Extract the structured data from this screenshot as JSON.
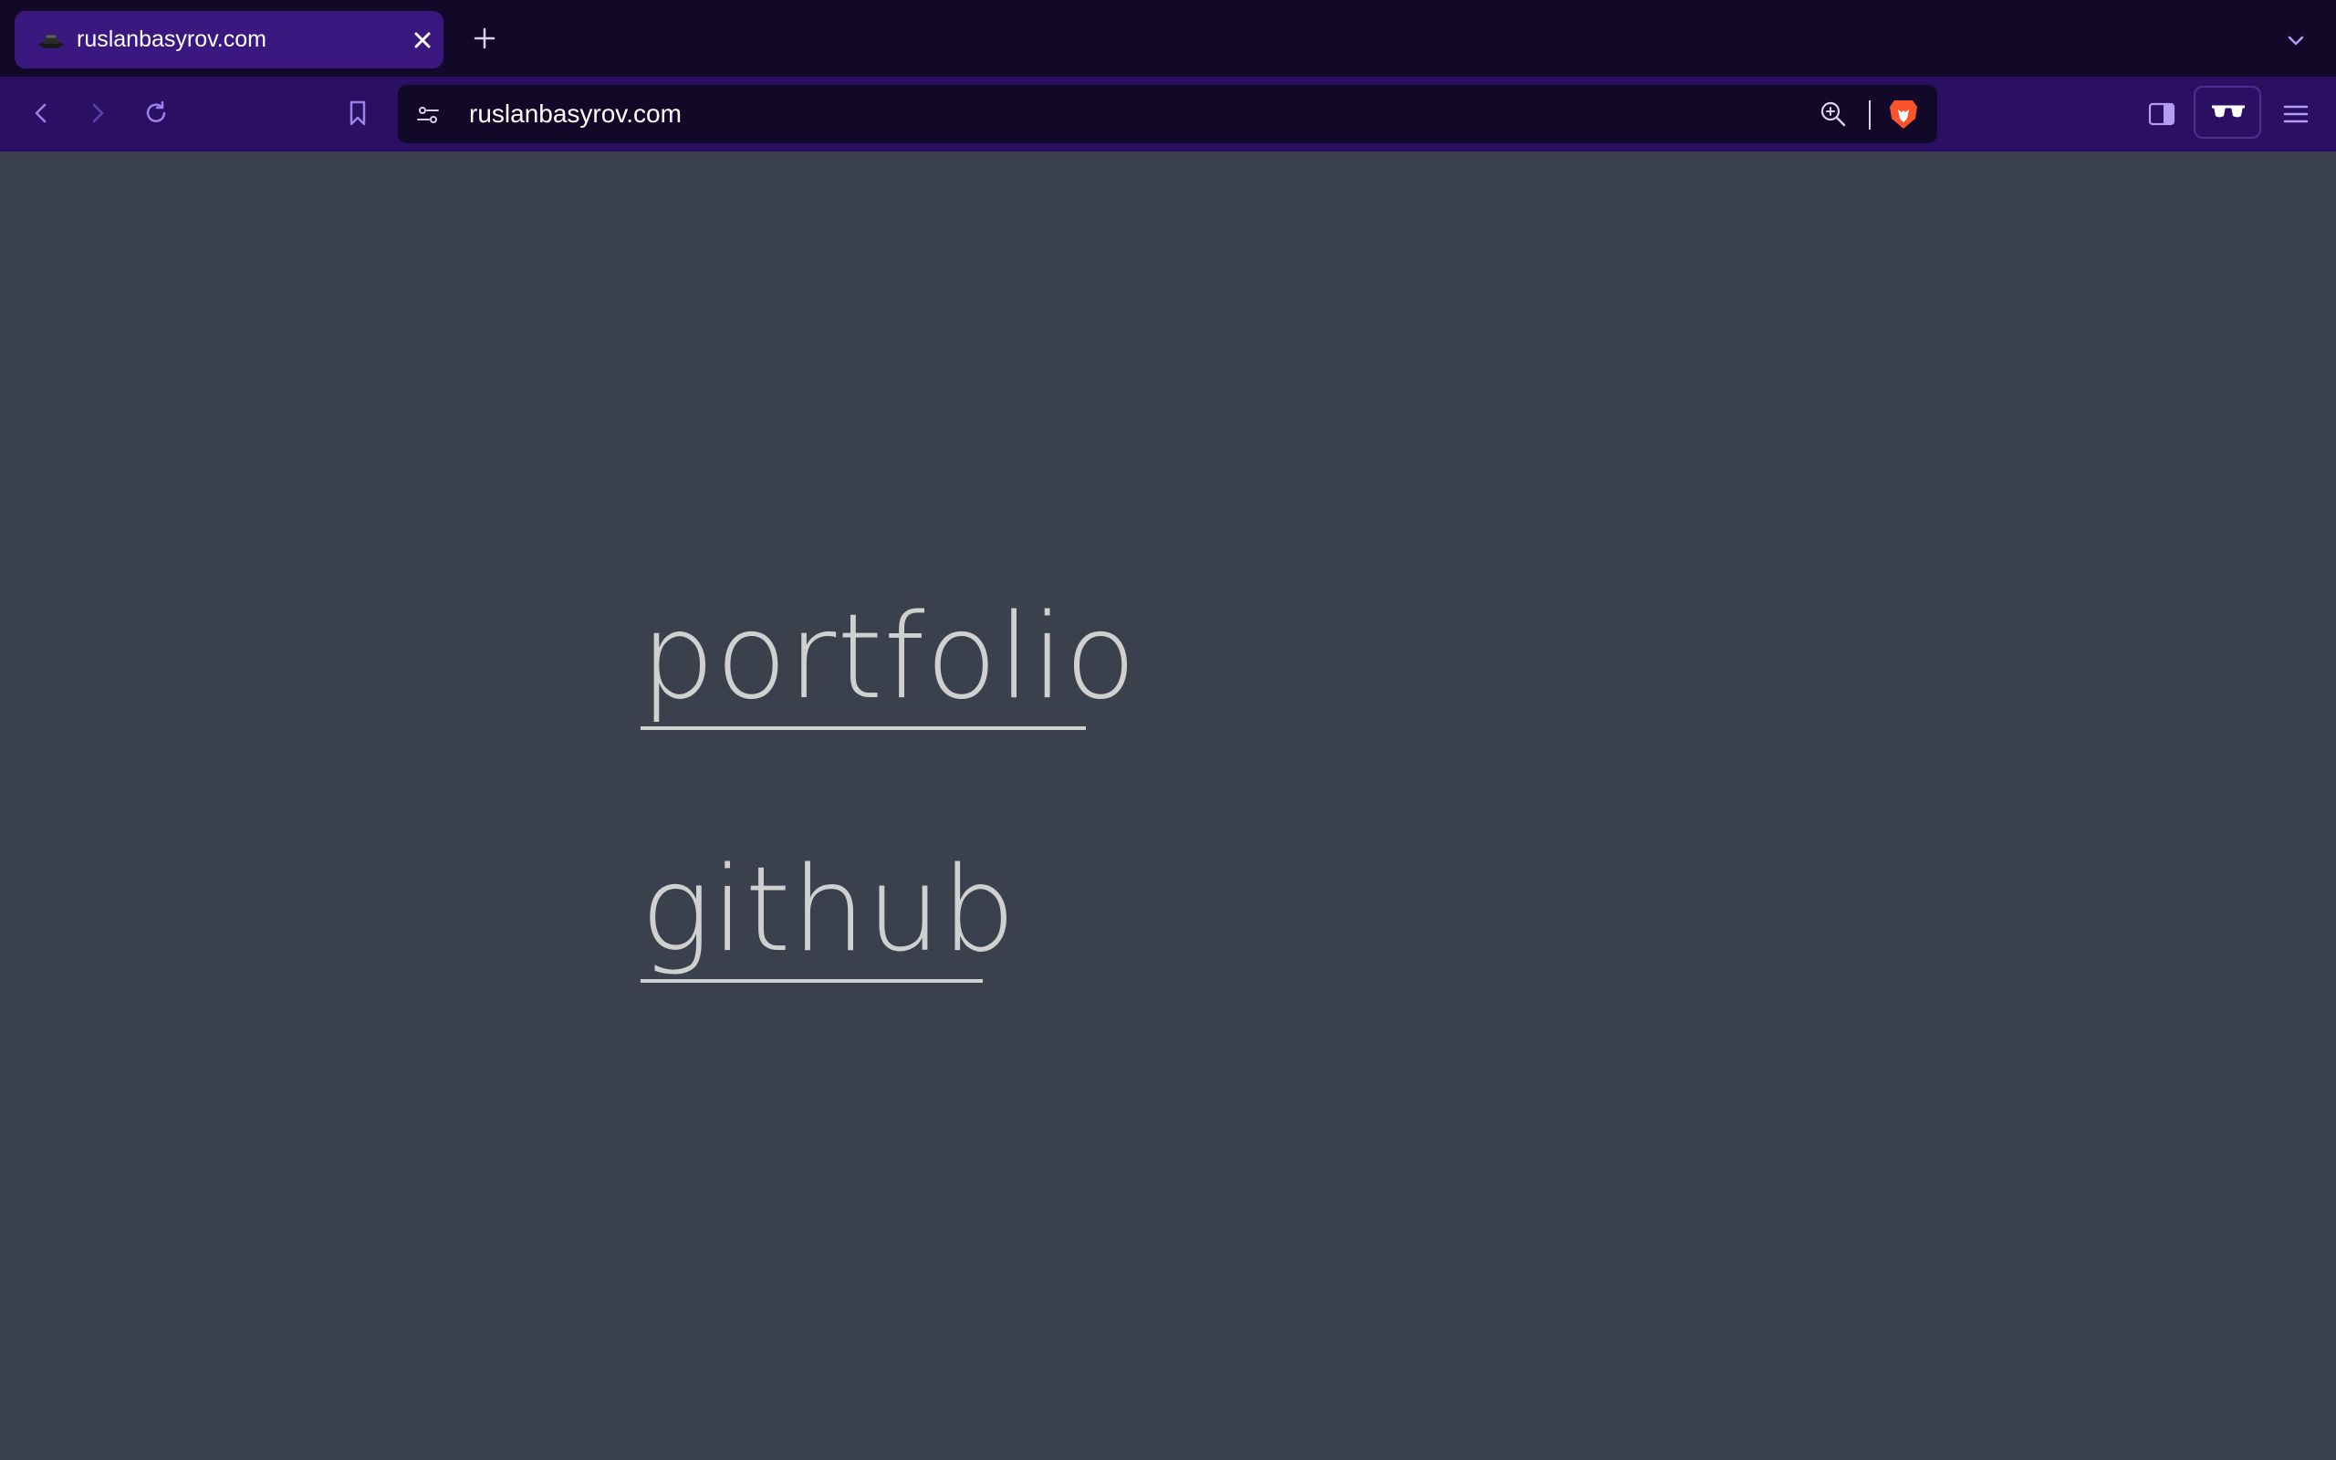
{
  "browser": {
    "tab": {
      "title": "ruslanbasyrov.com",
      "favicon": "hat-icon",
      "close_icon": "close-icon"
    },
    "new_tab_icon": "plus-icon",
    "tab_list_icon": "chevron-down-icon",
    "toolbar": {
      "back_icon": "back-arrow-icon",
      "forward_icon": "forward-arrow-icon",
      "reload_icon": "reload-icon",
      "bookmark_icon": "bookmark-icon",
      "site_settings_icon": "site-settings-icon",
      "address": "ruslanbasyrov.com",
      "zoom_icon": "zoom-in-icon",
      "shields_icon": "brave-lion-icon",
      "sidebar_icon": "sidebar-icon",
      "reader_icon": "glasses-icon",
      "menu_icon": "hamburger-menu-icon"
    }
  },
  "page": {
    "links": [
      {
        "label": "portfolio"
      },
      {
        "label": "github"
      }
    ]
  },
  "colors": {
    "tab_strip": "#120828",
    "active_tab": "#3a1880",
    "toolbar": "#2a0f63",
    "page_background": "#3a404c",
    "link_text": "#d0d0d0",
    "brave_orange": "#fb542b"
  }
}
